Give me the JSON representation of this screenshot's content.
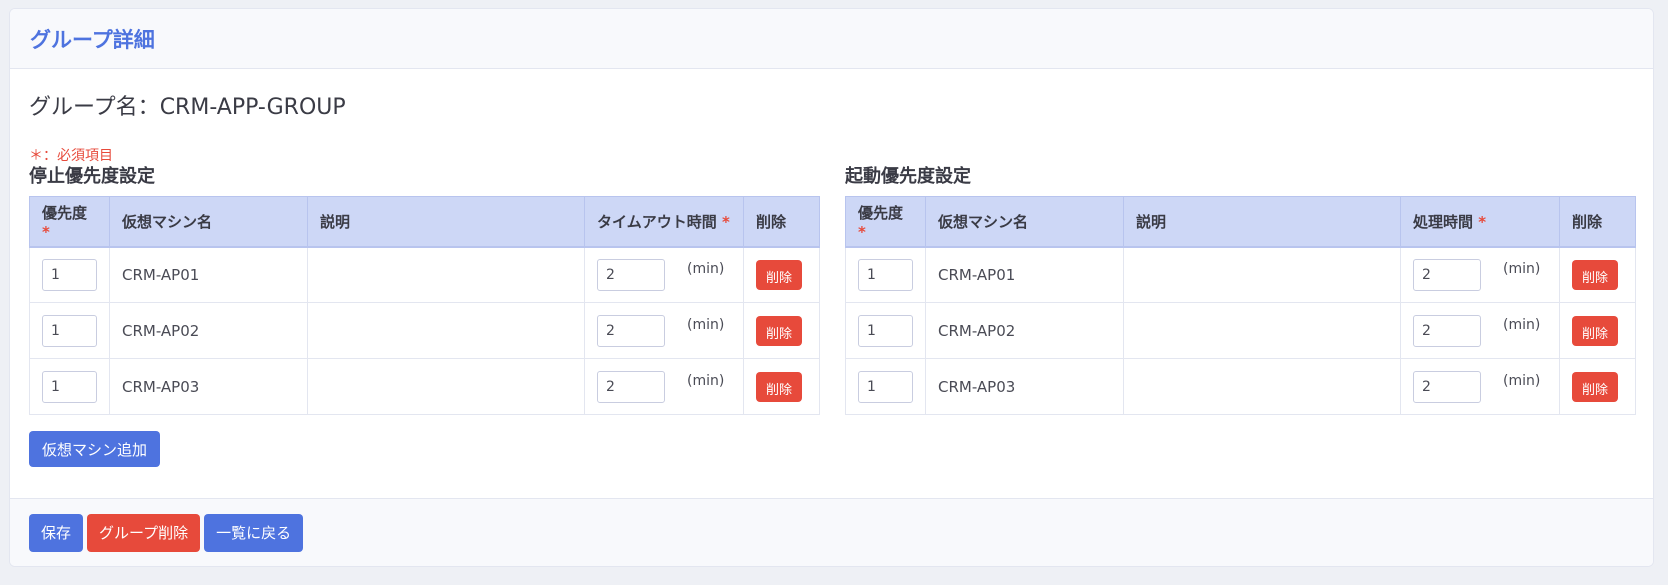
{
  "header": {
    "title": "グループ詳細"
  },
  "group": {
    "label": "グループ名：",
    "name": "CRM-APP-GROUP"
  },
  "required_note": "＊：必須項目",
  "stop_panel": {
    "title": "停止優先度設定",
    "columns": {
      "priority": "優先度",
      "vm_name": "仮想マシン名",
      "description": "説明",
      "time": "タイムアウト時間",
      "delete": "削除"
    },
    "rows": [
      {
        "priority": "1",
        "vm_name": "CRM-AP01",
        "description": "",
        "time": "2",
        "unit": "(min)",
        "delete_label": "削除"
      },
      {
        "priority": "1",
        "vm_name": "CRM-AP02",
        "description": "",
        "time": "2",
        "unit": "(min)",
        "delete_label": "削除"
      },
      {
        "priority": "1",
        "vm_name": "CRM-AP03",
        "description": "",
        "time": "2",
        "unit": "(min)",
        "delete_label": "削除"
      }
    ]
  },
  "start_panel": {
    "title": "起動優先度設定",
    "columns": {
      "priority": "優先度",
      "vm_name": "仮想マシン名",
      "description": "説明",
      "time": "処理時間",
      "delete": "削除"
    },
    "rows": [
      {
        "priority": "1",
        "vm_name": "CRM-AP01",
        "description": "",
        "time": "2",
        "unit": "(min)",
        "delete_label": "削除"
      },
      {
        "priority": "1",
        "vm_name": "CRM-AP02",
        "description": "",
        "time": "2",
        "unit": "(min)",
        "delete_label": "削除"
      },
      {
        "priority": "1",
        "vm_name": "CRM-AP03",
        "description": "",
        "time": "2",
        "unit": "(min)",
        "delete_label": "削除"
      }
    ]
  },
  "required_mark": "*",
  "add_vm_label": "仮想マシン追加",
  "footer": {
    "save_label": "保存",
    "delete_group_label": "グループ削除",
    "back_label": "一覧に戻る"
  },
  "colors": {
    "primary": "#4e73df",
    "danger": "#e74a3b",
    "table_header": "#cdd7f6"
  }
}
